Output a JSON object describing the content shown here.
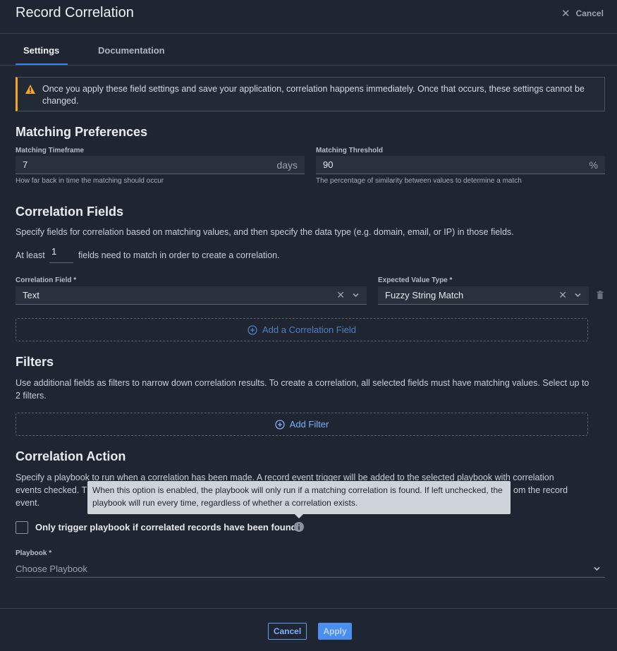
{
  "header": {
    "title": "Record Correlation",
    "cancel_label": "Cancel"
  },
  "tabs": [
    {
      "label": "Settings",
      "active": true
    },
    {
      "label": "Documentation",
      "active": false
    }
  ],
  "warning": {
    "icon": "warning-icon",
    "text": "Once you apply these field settings and save your application, correlation happens immediately. Once that occurs, these settings cannot be changed."
  },
  "matching": {
    "title": "Matching Preferences",
    "timeframe": {
      "label": "Matching Timeframe",
      "value": "7",
      "suffix": "days",
      "hint": "How far back in time the matching should occur"
    },
    "threshold": {
      "label": "Matching Threshold",
      "value": "90",
      "suffix": "%",
      "hint": "The percentage of similarity between values to determine a match"
    }
  },
  "correlation_fields": {
    "title": "Correlation Fields",
    "description": "Specify fields for correlation based on matching values, and then specify the data type (e.g. domain, email, or IP) in those fields.",
    "at_least_prefix": "At least",
    "at_least_value": "1",
    "at_least_suffix": "fields need to match in order to create a correlation.",
    "field_label": "Correlation Field *",
    "field_value": "Text",
    "type_label": "Expected Value Type *",
    "type_value": "Fuzzy String Match",
    "add_label": "Add a Correlation Field"
  },
  "filters": {
    "title": "Filters",
    "description": "Use additional fields as filters to narrow down correlation results. To create a correlation, all selected fields must have matching values. Select up to 2 filters.",
    "add_label": "Add Filter"
  },
  "action": {
    "title": "Correlation Action",
    "line1": "Specify a playbook to run when a correlation has been made. A record event trigger will be added to the selected playbook with correlation",
    "line2_start": "events checked. T",
    "line2_end": "om the record",
    "line3": "event.",
    "checkbox_label": "Only trigger playbook if correlated records have been found.",
    "checkbox_checked": false,
    "tooltip": "When this option is enabled, the playbook will only run if a matching correlation is found. If left unchecked, the playbook will run every time, regardless of whether a correlation exists.",
    "playbook_label": "Playbook *",
    "playbook_placeholder": "Choose Playbook"
  },
  "footer": {
    "cancel_label": "Cancel",
    "apply_label": "Apply"
  },
  "colors": {
    "accent": "#3b82f6",
    "warning": "#f5a623",
    "background": "#202631"
  }
}
